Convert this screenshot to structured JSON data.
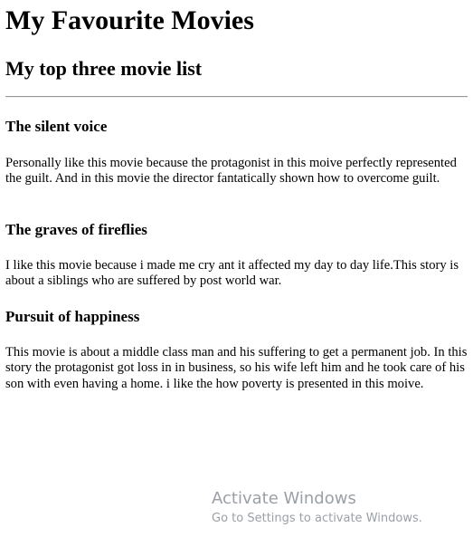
{
  "page": {
    "title": "My Favourite Movies",
    "subtitle": "My top three movie list"
  },
  "movies": [
    {
      "title": "The silent voice",
      "description": "Personally like this movie because the protagonist in this moive perfectly represented the guilt. And in this movie the director fantatically shown how to overcome guilt."
    },
    {
      "title": "The graves of fireflies",
      "description": "I like this movie because i made me cry ant it affected my day to day life.This story is about a siblings who are suffered by post world war."
    },
    {
      "title": "Pursuit of happiness",
      "description": "This movie is about a middle class man and his suffering to get a permanent job. In this story the protagonist got loss in in business, so his wife left him and he took care of his son with even having a home. i like the how poverty is presented in this moive."
    }
  ],
  "watermark": {
    "title": "Activate Windows",
    "subtitle": "Go to Settings to activate Windows."
  }
}
